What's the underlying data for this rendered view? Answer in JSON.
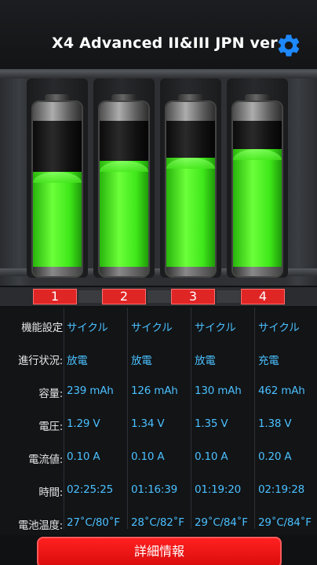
{
  "header": {
    "title": "X4 Advanced II&III JPN ver"
  },
  "icons": {
    "settings": "gear-icon"
  },
  "colors": {
    "accent": "#1e88ff",
    "value_text": "#4bc0ff",
    "slot_red": "#e02525",
    "battery_green": "#4be31c"
  },
  "slots": [
    {
      "number": "1",
      "charge_level": 0.6
    },
    {
      "number": "2",
      "charge_level": 0.66
    },
    {
      "number": "3",
      "charge_level": 0.68
    },
    {
      "number": "4",
      "charge_level": 0.73
    }
  ],
  "rows": [
    {
      "label": "機能設定",
      "values": [
        "サイクル",
        "サイクル",
        "サイクル",
        "サイクル"
      ]
    },
    {
      "label": "進行状況:",
      "values": [
        "放電",
        "放電",
        "放電",
        "充電"
      ]
    },
    {
      "label": "容量:",
      "values": [
        "239 mAh",
        "126 mAh",
        "130 mAh",
        "462 mAh"
      ]
    },
    {
      "label": "電圧:",
      "values": [
        "1.29 V",
        "1.34 V",
        "1.35 V",
        "1.38 V"
      ]
    },
    {
      "label": "電流値:",
      "values": [
        "0.10 A",
        "0.10 A",
        "0.10 A",
        "0.20 A"
      ]
    },
    {
      "label": "時間:",
      "values": [
        "02:25:25",
        "01:16:39",
        "01:19:20",
        "02:19:28"
      ]
    },
    {
      "label": "電池温度:",
      "values": [
        "27˚C/80˚F",
        "28˚C/82˚F",
        "29˚C/84˚F",
        "29˚C/84˚F"
      ]
    }
  ],
  "detail_button": {
    "label": "詳細情報"
  }
}
